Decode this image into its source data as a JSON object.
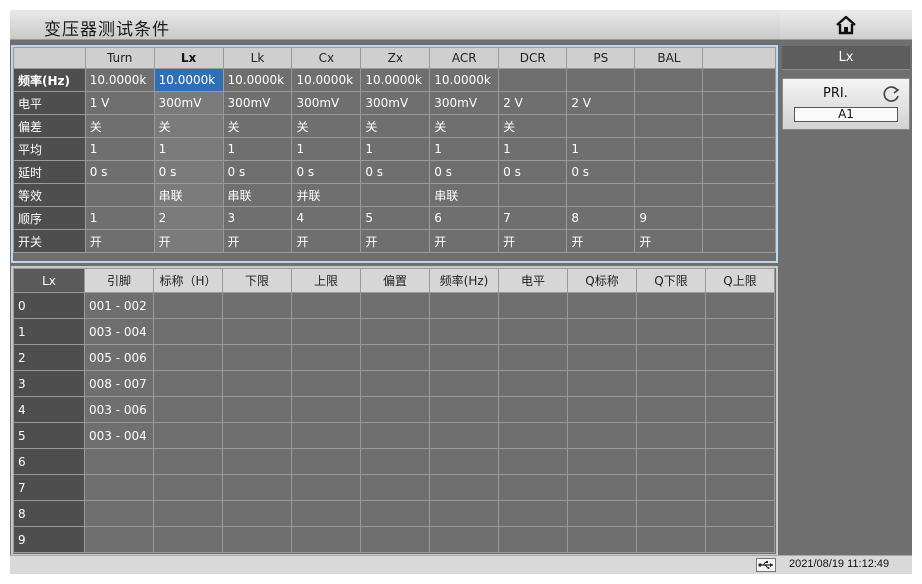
{
  "header": {
    "title": "变压器测试条件"
  },
  "icons": {
    "home": "home-icon",
    "refresh": "refresh-icon",
    "usb": "usb-icon"
  },
  "top_table": {
    "columns": [
      "",
      "Turn",
      "Lx",
      "Lk",
      "Cx",
      "Zx",
      "ACR",
      "DCR",
      "PS",
      "BAL",
      ""
    ],
    "rows": [
      {
        "label": "频率(Hz)",
        "cells": [
          "10.0000k",
          "10.0000k",
          "10.0000k",
          "10.0000k",
          "10.0000k",
          "10.0000k",
          "",
          "",
          "",
          ""
        ]
      },
      {
        "label": "电平",
        "cells": [
          "1 V",
          "300mV",
          "300mV",
          "300mV",
          "300mV",
          "300mV",
          "2 V",
          "2 V",
          "",
          ""
        ]
      },
      {
        "label": "偏差",
        "cells": [
          "关",
          "关",
          "关",
          "关",
          "关",
          "关",
          "关",
          "",
          "",
          ""
        ]
      },
      {
        "label": "平均",
        "cells": [
          "1",
          "1",
          "1",
          "1",
          "1",
          "1",
          "1",
          "1",
          "",
          ""
        ]
      },
      {
        "label": "延时",
        "cells": [
          "0 s",
          "0 s",
          "0 s",
          "0 s",
          "0 s",
          "0 s",
          "0 s",
          "0 s",
          "",
          ""
        ]
      },
      {
        "label": "等效",
        "cells": [
          "",
          "串联",
          "串联",
          "并联",
          "",
          "串联",
          "",
          "",
          "",
          ""
        ]
      },
      {
        "label": "顺序",
        "cells": [
          "1",
          "2",
          "3",
          "4",
          "5",
          "6",
          "7",
          "8",
          "9",
          ""
        ]
      },
      {
        "label": "开关",
        "cells": [
          "开",
          "开",
          "开",
          "开",
          "开",
          "开",
          "开",
          "开",
          "开",
          ""
        ]
      }
    ]
  },
  "bottom_table": {
    "columns": [
      "Lx",
      "引脚",
      "标称（H）",
      "下限",
      "上限",
      "偏置",
      "频率(Hz)",
      "电平",
      "Q标称",
      "Q下限",
      "Q上限"
    ],
    "rows": [
      {
        "index": "0",
        "pin": "001 - 002"
      },
      {
        "index": "1",
        "pin": "003 - 004"
      },
      {
        "index": "2",
        "pin": "005 - 006"
      },
      {
        "index": "3",
        "pin": "008 - 007"
      },
      {
        "index": "4",
        "pin": "003 - 006"
      },
      {
        "index": "5",
        "pin": "003 - 004"
      },
      {
        "index": "6",
        "pin": ""
      },
      {
        "index": "7",
        "pin": ""
      },
      {
        "index": "8",
        "pin": ""
      },
      {
        "index": "9",
        "pin": ""
      }
    ]
  },
  "sidebar": {
    "mode_label": "Lx",
    "pri_label": "PRI.",
    "pri_value": "A1"
  },
  "status": {
    "datetime": "2021/08/19 11:12:49"
  },
  "colors": {
    "selection": "#2e6fb8",
    "panel_border": "#bcd7f2",
    "background": "#6f6f6f"
  }
}
